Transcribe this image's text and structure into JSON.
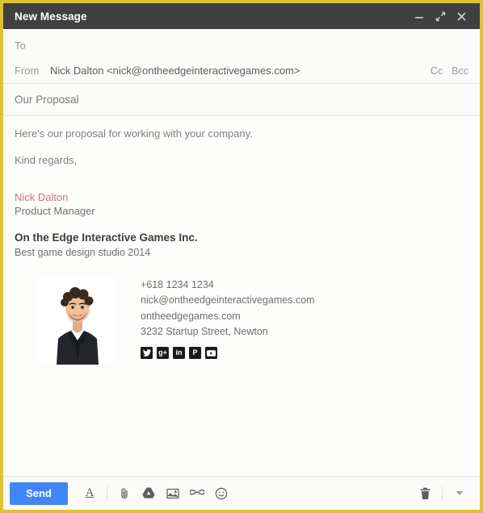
{
  "window": {
    "title": "New Message",
    "controls": {
      "minimize": "minimize-icon",
      "expand": "expand-icon",
      "close": "close-icon"
    },
    "border_color": "#dfc233",
    "titlebar_color": "#404040"
  },
  "compose": {
    "to": {
      "label": "To",
      "value": "",
      "placeholder": "To"
    },
    "from": {
      "label": "From",
      "value": "Nick Dalton <nick@ontheedgeinteractivegames.com>"
    },
    "cc_label": "Cc",
    "bcc_label": "Bcc",
    "subject": {
      "value": "Our Proposal",
      "placeholder": "Subject"
    }
  },
  "body": {
    "lines": [
      "Here's our proposal for working with your company.",
      "Kind regards,"
    ],
    "faint_mark": ""
  },
  "signature": {
    "name": "Nick Dalton",
    "name_color": "#d4717f",
    "role": "Product Manager",
    "company": "On the Edge Interactive Games Inc.",
    "tagline": "Best game design studio 2014",
    "photo_alt": "portrait-photo",
    "contact": [
      "+618 1234 1234",
      "nick@ontheedgeinteractivegames.com",
      "ontheedgegames.com",
      "3232 Startup Street, Newton"
    ],
    "social": [
      {
        "name": "twitter-icon",
        "glyph": "twitter"
      },
      {
        "name": "google-plus-icon",
        "glyph": "g+"
      },
      {
        "name": "linkedin-icon",
        "glyph": "in"
      },
      {
        "name": "pinterest-icon",
        "glyph": "P"
      },
      {
        "name": "youtube-icon",
        "glyph": "youtube"
      }
    ]
  },
  "toolbar": {
    "send_label": "Send",
    "send_color": "#4285f4",
    "format_label": "A",
    "icons": [
      {
        "name": "format-text-icon"
      },
      {
        "name": "attach-file-icon"
      },
      {
        "name": "google-drive-icon"
      },
      {
        "name": "insert-photo-icon"
      },
      {
        "name": "insert-link-icon"
      },
      {
        "name": "insert-emoji-icon"
      }
    ],
    "discard_icon": "trash-icon",
    "more_options_icon": "chevron-down-icon"
  }
}
